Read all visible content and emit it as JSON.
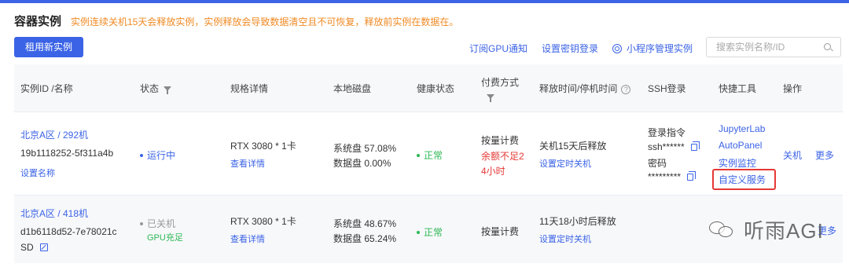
{
  "header": {
    "title": "容器实例",
    "notice": "实例连续关机15天会释放实例，实例释放会导致数据清空且不可恢复，释放前实例在数据在。"
  },
  "toolbar": {
    "rent_button": "租用新实例",
    "subscribe_link": "订阅GPU通知",
    "key_link": "设置密钥登录",
    "miniapp_link": "小程序管理实例",
    "search_placeholder": "搜索实例名称/ID"
  },
  "columns": {
    "id_name": "实例ID /名称",
    "status": "状态",
    "spec": "规格详情",
    "disk": "本地磁盘",
    "health": "健康状态",
    "billing_line1": "付费方式",
    "release": "释放时间/停机时间",
    "ssh": "SSH登录",
    "tools": "快捷工具",
    "ops": "操作"
  },
  "rows": [
    {
      "region": "北京A区 / 292机",
      "id": "19b1118252-5f311a4b",
      "name_action": "设置名称",
      "status": "运行中",
      "spec": "RTX 3080 * 1卡",
      "spec_link": "查看详情",
      "sys_disk": "系统盘 57.08%",
      "data_disk": "数据盘 0.00%",
      "health": "正常",
      "billing": "按量计费",
      "billing_warn_1": "余额不足2",
      "billing_warn_2": "4小时",
      "release": "关机15天后释放",
      "release_link": "设置定时关机",
      "ssh_cmd_label": "登录指令",
      "ssh_cmd_value": "ssh******",
      "ssh_pwd_label": "密码",
      "ssh_pwd_value": "*********",
      "tool_jupyter": "JupyterLab",
      "tool_autopanel": "AutoPanel",
      "tool_monitor": "实例监控",
      "tool_custom": "自定义服务",
      "op_shutdown": "关机",
      "op_more": "更多"
    },
    {
      "region": "北京A区 / 418机",
      "id_line1": "d1b6118d52-7e78021c",
      "id_line2": "SD",
      "status": "已关机",
      "gpu_status": "GPU充足",
      "spec": "RTX 3080 * 1卡",
      "spec_link": "查看详情",
      "sys_disk": "系统盘 48.67%",
      "data_disk": "数据盘 65.24%",
      "health": "正常",
      "billing": "按量计费",
      "release": "11天18小时后释放",
      "release_link": "设置定时关机",
      "op_more": "更多"
    }
  ],
  "watermark": {
    "text": "听雨AGI"
  },
  "colors": {
    "primary": "#3b63e6",
    "warning": "#f08a24",
    "danger": "#e53935",
    "success": "#2db855"
  }
}
